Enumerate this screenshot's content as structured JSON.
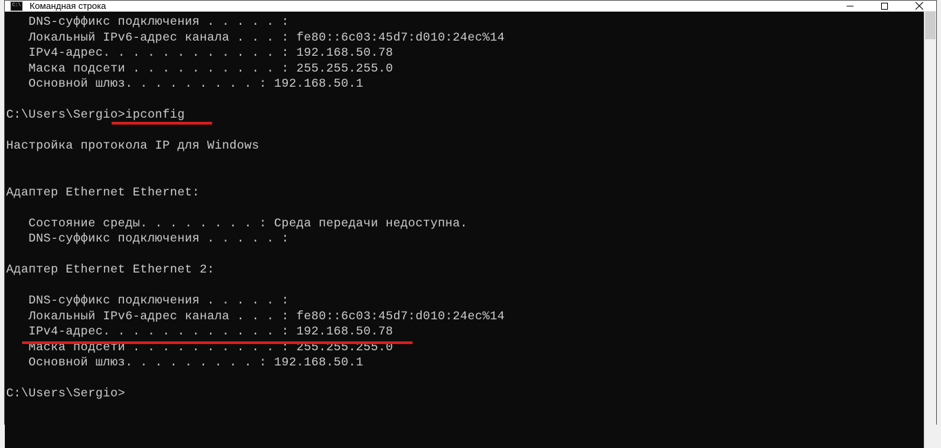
{
  "titlebar": {
    "title": "Командная строка"
  },
  "terminal": {
    "lines": {
      "l1": "   DNS-суффикс подключения . . . . . :",
      "l2": "   Локальный IPv6-адрес канала . . . : fe80::6c03:45d7:d010:24ec%14",
      "l3": "   IPv4-адрес. . . . . . . . . . . . : 192.168.50.78",
      "l4": "   Маска подсети . . . . . . . . . . : 255.255.255.0",
      "l5": "   Основной шлюз. . . . . . . . . : 192.168.50.1",
      "l6": "",
      "l7": "C:\\Users\\Sergio>ipconfig",
      "l8": "",
      "l9": "Настройка протокола IP для Windows",
      "l10": "",
      "l11": "",
      "l12": "Адаптер Ethernet Ethernet:",
      "l13": "",
      "l14": "   Состояние среды. . . . . . . . : Среда передачи недоступна.",
      "l15": "   DNS-суффикс подключения . . . . . :",
      "l16": "",
      "l17": "Адаптер Ethernet Ethernet 2:",
      "l18": "",
      "l19": "   DNS-суффикс подключения . . . . . :",
      "l20": "   Локальный IPv6-адрес канала . . . : fe80::6c03:45d7:d010:24ec%14",
      "l21": "   IPv4-адрес. . . . . . . . . . . . : 192.168.50.78",
      "l22": "   Маска подсети . . . . . . . . . . : 255.255.255.0",
      "l23": "   Основной шлюз. . . . . . . . . : 192.168.50.1",
      "l24": "",
      "l25": "C:\\Users\\Sergio>"
    }
  }
}
